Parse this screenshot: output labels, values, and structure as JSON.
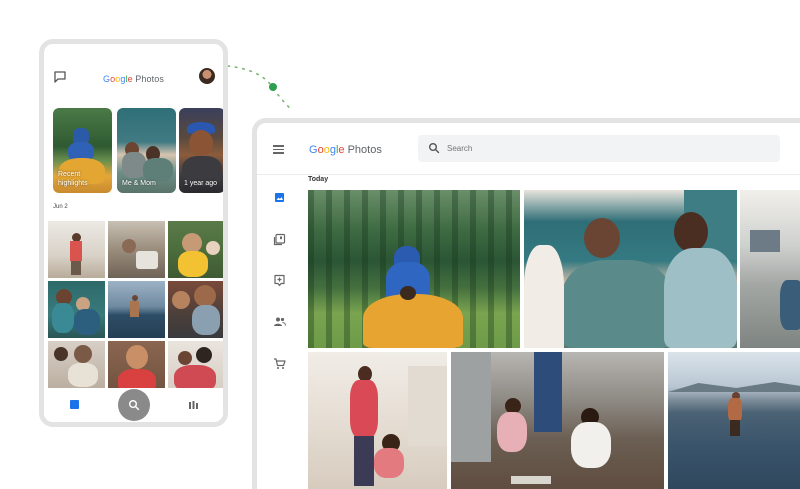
{
  "colors": {
    "blue": "#4285f4",
    "red": "#ea4335",
    "yellow": "#fbbc05",
    "green": "#34a853",
    "accent_active": "#1a73e8",
    "dot_green": "#2e9e4f"
  },
  "phone": {
    "logo": {
      "g": "G",
      "o1": "o",
      "o2": "o",
      "g2": "g",
      "l": "l",
      "e": "e",
      "photos": " Photos"
    },
    "header_icons": {
      "left": "chat-icon",
      "right": "avatar"
    },
    "highlights": [
      {
        "label": "Recent\nhighlights"
      },
      {
        "label": "Me & Mom"
      },
      {
        "label": "1 year ago"
      }
    ],
    "date": "Jun 2",
    "nav": {
      "photos_icon": "photos-icon",
      "search_icon": "search-icon",
      "library_icon": "library-icon"
    }
  },
  "desktop": {
    "menu_icon": "menu-icon",
    "logo": {
      "g": "G",
      "o1": "o",
      "o2": "o",
      "g2": "g",
      "l": "l",
      "e": "e",
      "photos": " Photos"
    },
    "search": {
      "placeholder": "Search",
      "value": ""
    },
    "sidebar": [
      {
        "icon": "photos-icon",
        "active": true
      },
      {
        "icon": "albums-icon",
        "active": false
      },
      {
        "icon": "assistant-icon",
        "active": false
      },
      {
        "icon": "sharing-icon",
        "active": false
      },
      {
        "icon": "cart-icon",
        "active": false
      }
    ],
    "section_label": "Today"
  }
}
